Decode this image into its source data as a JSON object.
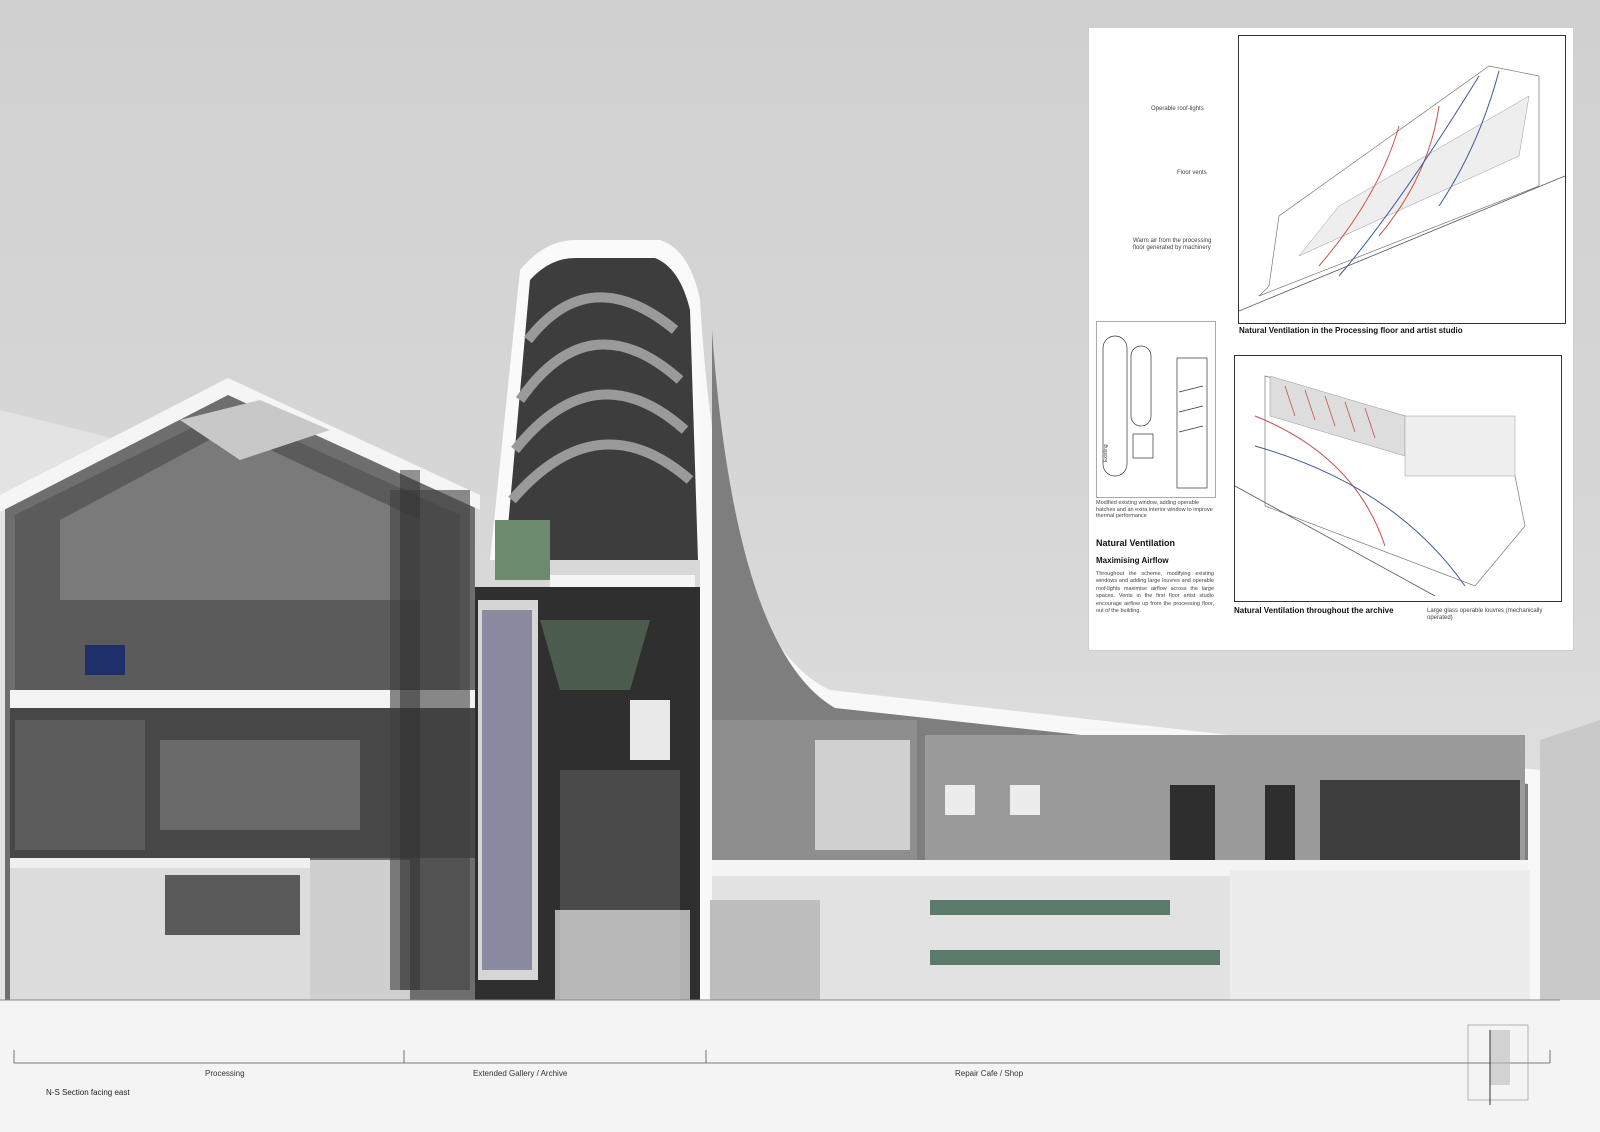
{
  "section": {
    "zones": [
      {
        "label": "Processing"
      },
      {
        "label": "Extended Gallery / Archive"
      },
      {
        "label": "Repair Cafe / Shop"
      }
    ],
    "title": "N-S Section facing east"
  },
  "panel": {
    "top_diagram": {
      "caption": "Natural Ventilation in the Processing floor and artist studio",
      "annotations": [
        "Operable roof-lights",
        "Floor vents",
        "Warm air from the processing floor generated by machinery"
      ]
    },
    "window_detail": {
      "caption": "Modified existing window, adding operable hatches and an extra interior window to improve thermal performance",
      "label_existing": "Existing"
    },
    "text": {
      "heading": "Natural Ventilation",
      "subheading": "Maximising Airflow",
      "body": "Throughout the scheme, modifying existing windows and adding large louvres and operable roof-lights maximise airflow across the large spaces. Vents in the first floor artist studio encourage airflow up from the processing floor, out of the building."
    },
    "bottom_diagram": {
      "caption": "Natural Ventilation throughout the archive",
      "annotation": "Large glass operable louvres (mechanically operated)"
    }
  },
  "colors": {
    "sky": "#d5d5d5",
    "building_dark": "#4a4a4a",
    "building_mid": "#8a8a8a",
    "building_light": "#f2f2f2",
    "green_panel": "#6b8a6e",
    "airflow_red": "#c8504a",
    "airflow_blue": "#3a5a9a"
  }
}
